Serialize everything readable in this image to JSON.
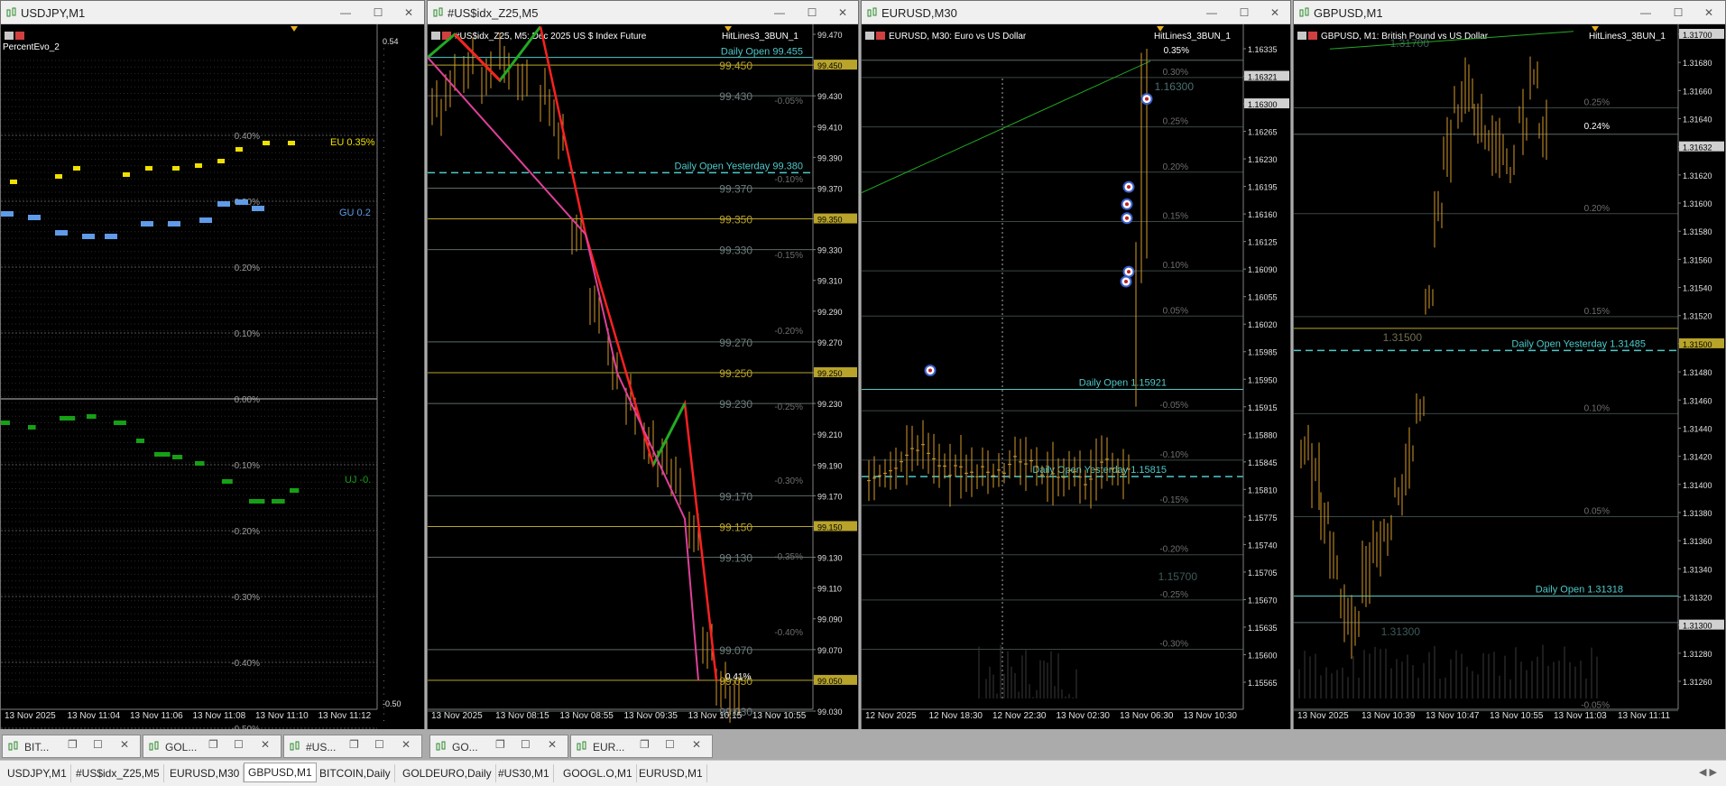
{
  "windows": [
    {
      "title": "USDJPY,M1",
      "subtitle": "PercentEvo_2",
      "left_labels": [
        "EU 0.35%",
        "GU 0.2",
        "UJ -0."
      ],
      "pct_labels": [
        "0.40%",
        "0.30%",
        "0.20%",
        "0.10%",
        "0.00%",
        "-0.10%",
        "-0.20%",
        "-0.30%",
        "-0.40%",
        "-0.50%"
      ],
      "right_top": "0.54",
      "right_bottom": "-0.50",
      "time_labels": [
        "13 Nov 2025",
        "13 Nov 11:04",
        "13 Nov 11:06",
        "13 Nov 11:08",
        "13 Nov 11:10",
        "13 Nov 11:12"
      ]
    },
    {
      "title": "#US$idx_Z25,M5",
      "chart_title": "#US$idx_Z25, M5:  Dec 2025 US $ Index Future",
      "indicator": "HitLines3_3BUN_1",
      "lines": [
        "Daily Open 99.455",
        "Daily Open Yesterday 99.380",
        "0.41%"
      ],
      "levels": [
        "99.450",
        "99.430",
        "99.370",
        "99.350",
        "99.330",
        "99.270",
        "99.250",
        "99.230",
        "99.170",
        "99.150",
        "99.130",
        "99.070",
        "99.050",
        "99.030"
      ],
      "pcts": [
        "-0.05%",
        "-0.10%",
        "-0.15%",
        "-0.20%",
        "-0.25%",
        "-0.30%",
        "-0.35%",
        "-0.40%"
      ],
      "price_axis": [
        "99.470",
        "99.450",
        "99.430",
        "99.410",
        "99.390",
        "99.370",
        "99.350",
        "99.330",
        "99.310",
        "99.290",
        "99.270",
        "99.250",
        "99.230",
        "99.210",
        "99.190",
        "99.170",
        "99.150",
        "99.130",
        "99.110",
        "99.090",
        "99.070",
        "99.050",
        "99.030"
      ],
      "time_labels": [
        "13 Nov 2025",
        "13 Nov 08:15",
        "13 Nov 08:55",
        "13 Nov 09:35",
        "13 Nov 10:15",
        "13 Nov 10:55"
      ]
    },
    {
      "title": "EURUSD,M30",
      "chart_title": "EURUSD, M30:  Euro vs US Dollar",
      "indicator": "HitLines3_3BUN_1",
      "lines": [
        "Daily Open 1.15921",
        "Daily Open Yesterday 1.15815",
        "0.35%",
        "1.16300",
        "1.15700"
      ],
      "pcts": [
        "0.30%",
        "0.25%",
        "0.20%",
        "0.15%",
        "0.10%",
        "0.05%",
        "-0.05%",
        "-0.10%",
        "-0.15%",
        "-0.20%",
        "-0.25%",
        "-0.30%"
      ],
      "price_axis": [
        "1.16335",
        "1.16321",
        "1.16300",
        "1.16265",
        "1.16230",
        "1.16195",
        "1.16160",
        "1.16125",
        "1.16090",
        "1.16055",
        "1.16020",
        "1.15985",
        "1.15950",
        "1.15915",
        "1.15880",
        "1.15845",
        "1.15810",
        "1.15775",
        "1.15740",
        "1.15705",
        "1.15670",
        "1.15635",
        "1.15600",
        "1.15565"
      ],
      "time_labels": [
        "12 Nov 2025",
        "12 Nov 18:30",
        "12 Nov 22:30",
        "13 Nov 02:30",
        "13 Nov 06:30",
        "13 Nov 10:30"
      ]
    },
    {
      "title": "GBPUSD,M1",
      "chart_title": "GBPUSD, M1:  British Pound vs US Dollar",
      "indicator": "HitLines3_3BUN_1",
      "lines": [
        "Daily Open Yesterday 1.31485",
        "Daily Open 1.31318",
        "0.24%",
        "1.31700",
        "1.31500",
        "1.31300"
      ],
      "pcts": [
        "0.25%",
        "0.20%",
        "0.15%",
        "0.10%",
        "0.05%",
        "-0.05%"
      ],
      "price_axis": [
        "1.31700",
        "1.31680",
        "1.31660",
        "1.31640",
        "1.31632",
        "1.31620",
        "1.31600",
        "1.31580",
        "1.31560",
        "1.31540",
        "1.31520",
        "1.31500",
        "1.31480",
        "1.31460",
        "1.31440",
        "1.31420",
        "1.31400",
        "1.31380",
        "1.31360",
        "1.31340",
        "1.31320",
        "1.31300",
        "1.31280",
        "1.31260"
      ],
      "time_labels": [
        "13 Nov 2025",
        "13 Nov 10:39",
        "13 Nov 10:47",
        "13 Nov 10:55",
        "13 Nov 11:03",
        "13 Nov 11:11"
      ]
    }
  ],
  "minimized": [
    "BIT...",
    "GOL...",
    "#US...",
    "GO...",
    "EUR..."
  ],
  "tabs": [
    "USDJPY,M1",
    "#US$idx_Z25,M5",
    "EURUSD,M30",
    "GBPUSD,M1",
    "BITCOIN,Daily",
    "GOLDEURO,Daily",
    "#US30,M1",
    "GOOGL.O,M1",
    "EURUSD,M1"
  ],
  "active_tab": "GBPUSD,M1",
  "colors": {
    "bg": "#000000",
    "candle": "#d69a2a",
    "level": "#b8a42a",
    "cyan": "#4fc9c9",
    "grid": "#3a3a3a",
    "red": "#ff2020",
    "green": "#22aa22",
    "magenta": "#e0409a"
  }
}
